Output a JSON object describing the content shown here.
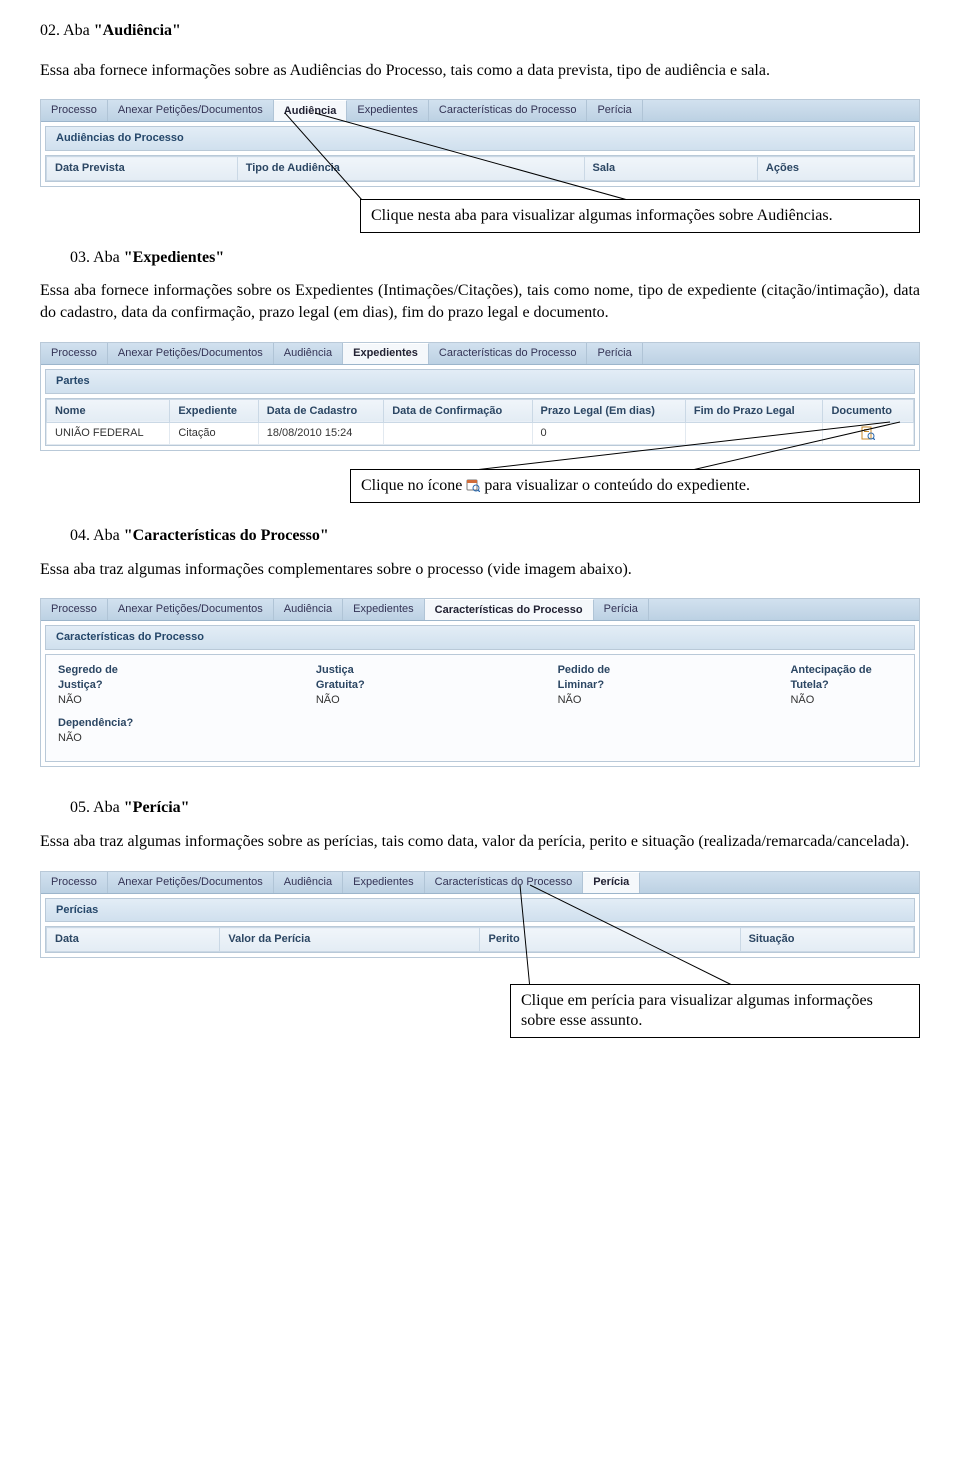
{
  "sec02": {
    "heading_prefix": "02. Aba ",
    "heading_quoted": "\"Audiência\"",
    "para": "Essa aba fornece informações sobre as Audiências do Processo, tais como a data prevista, tipo de audiência e sala.",
    "tabs": [
      "Processo",
      "Anexar Petições/Documentos",
      "Audiência",
      "Expedientes",
      "Características do Processo",
      "Perícia"
    ],
    "active_tab_index": 2,
    "panel_title": "Audiências do Processo",
    "columns": [
      "Data Prevista",
      "Tipo de Audiência",
      "Sala",
      "Ações"
    ],
    "callout": "Clique nesta aba para visualizar algumas informações sobre Audiências."
  },
  "sec03": {
    "heading_prefix": "03. Aba ",
    "heading_quoted": "\"Expedientes\"",
    "para": "Essa aba fornece informações sobre os Expedientes (Intimações/Citações), tais como nome, tipo de expediente (citação/intimação), data do cadastro, data da confirmação, prazo legal (em dias), fim do prazo legal e documento.",
    "tabs": [
      "Processo",
      "Anexar Petições/Documentos",
      "Audiência",
      "Expedientes",
      "Características do Processo",
      "Perícia"
    ],
    "active_tab_index": 3,
    "panel_title": "Partes",
    "columns": [
      "Nome",
      "Expediente",
      "Data de Cadastro",
      "Data de Confirmação",
      "Prazo Legal (Em dias)",
      "Fim do Prazo Legal",
      "Documento"
    ],
    "row": {
      "nome": "UNIÃO FEDERAL",
      "expediente": "Citação",
      "data_cadastro": "18/08/2010 15:24",
      "data_confirmacao": "",
      "prazo_legal": "0",
      "fim_prazo": "",
      "documento_icon": "doc-icon"
    },
    "callout_before": "Clique no ícone ",
    "callout_after": " para visualizar o conteúdo do expediente."
  },
  "sec04": {
    "heading_prefix": "04. Aba ",
    "heading_quoted": "\"Características do Processo\"",
    "para": "Essa aba traz algumas informações complementares sobre o processo (vide imagem abaixo).",
    "tabs": [
      "Processo",
      "Anexar Petições/Documentos",
      "Audiência",
      "Expedientes",
      "Características do Processo",
      "Perícia"
    ],
    "active_tab_index": 4,
    "panel_title": "Características do Processo",
    "fields": [
      {
        "label": "Segredo de Justiça?",
        "value": "NÃO"
      },
      {
        "label": "Justiça Gratuita?",
        "value": "NÃO"
      },
      {
        "label": "Pedido de Liminar?",
        "value": "NÃO"
      },
      {
        "label": "Antecipação de Tutela?",
        "value": "NÃO"
      },
      {
        "label": "Dependência?",
        "value": "NÃO"
      }
    ]
  },
  "sec05": {
    "heading_prefix": "05. Aba ",
    "heading_quoted": "\"Perícia\"",
    "para": "Essa aba traz algumas informações sobre as perícias, tais como data, valor da perícia, perito e situação (realizada/remarcada/cancelada).",
    "tabs": [
      "Processo",
      "Anexar Petições/Documentos",
      "Audiência",
      "Expedientes",
      "Características do Processo",
      "Perícia"
    ],
    "active_tab_index": 5,
    "panel_title": "Perícias",
    "columns": [
      "Data",
      "Valor da Perícia",
      "Perito",
      "Situação"
    ],
    "callout": "Clique em perícia para visualizar algumas informações sobre esse assunto."
  }
}
